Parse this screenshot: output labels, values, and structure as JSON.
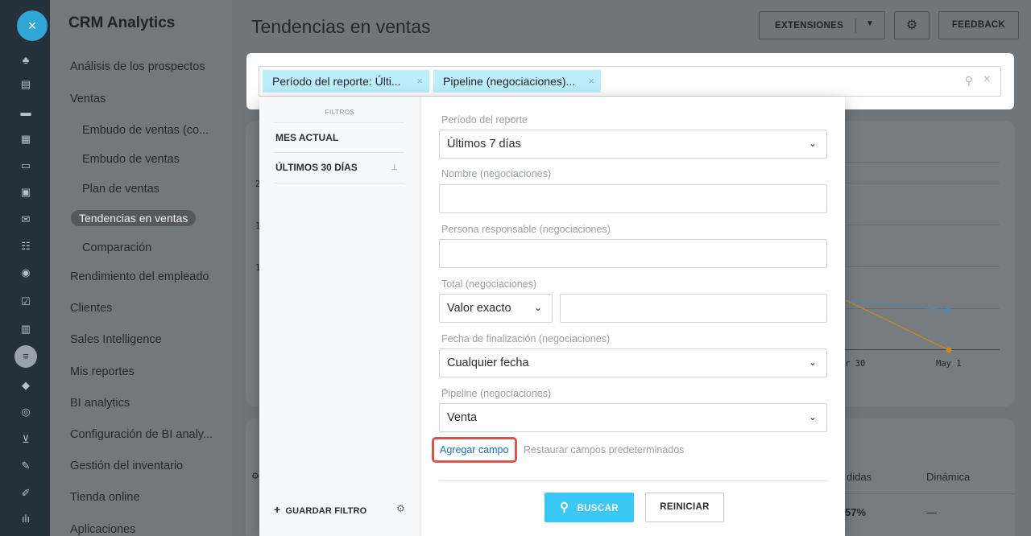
{
  "rail": {
    "close_label": "×",
    "icons": [
      "♣",
      "▤",
      "▬",
      "▦",
      "▭",
      "▣",
      "✉",
      "☷",
      "◉",
      "☑",
      "▥",
      "≡",
      "◆",
      "◎",
      "⊻",
      "✎",
      "✐",
      "ılı"
    ]
  },
  "nav": {
    "title": "CRM Analytics",
    "items": [
      {
        "label": "Análisis de los prospectos"
      },
      {
        "label": "Ventas"
      },
      {
        "label": "Embudo de ventas (co..."
      },
      {
        "label": "Embudo de ventas"
      },
      {
        "label": "Plan de ventas"
      },
      {
        "label": "Tendencias en ventas"
      },
      {
        "label": "Comparación"
      },
      {
        "label": "Rendimiento del empleado"
      },
      {
        "label": "Clientes"
      },
      {
        "label": "Sales Intelligence"
      },
      {
        "label": "Mis reportes"
      },
      {
        "label": "BI analytics"
      },
      {
        "label": "Configuración de BI analy..."
      },
      {
        "label": "Gestión del inventario"
      },
      {
        "label": "Tienda online"
      },
      {
        "label": "Aplicaciones"
      }
    ]
  },
  "header": {
    "title": "Tendencias en ventas",
    "extensions_label": "EXTENSIONES",
    "chevron": "▼",
    "gear": "⚙",
    "feedback_label": "FEEDBACK"
  },
  "filter_bar": {
    "chips": [
      {
        "label": "Período del reporte: Últi...",
        "remove": "×"
      },
      {
        "label": "Pipeline (negociaciones)...",
        "remove": "×"
      }
    ],
    "search_icon": "⚲",
    "clear_icon": "×"
  },
  "presets": {
    "header": "FILTROS",
    "items": [
      {
        "label": "MES ACTUAL"
      },
      {
        "label": "ÚLTIMOS 30 DÍAS",
        "pin": "⊥"
      }
    ],
    "save_plus": "+",
    "save_label": "GUARDAR FILTRO",
    "gear": "⚙"
  },
  "fields": {
    "period": {
      "label": "Período del reporte",
      "value": "Últimos 7 días"
    },
    "name": {
      "label": "Nombre (negociaciones)",
      "value": ""
    },
    "responsible": {
      "label": "Persona responsable (negociaciones)",
      "value": ""
    },
    "total": {
      "label": "Total (negociaciones)",
      "mode": "Valor exacto",
      "value": ""
    },
    "close_date": {
      "label": "Fecha de finalización (negociaciones)",
      "value": "Cualquier fecha"
    },
    "pipeline": {
      "label": "Pipeline (negociaciones)",
      "value": "Venta"
    },
    "caret": "⌄"
  },
  "actions": {
    "add_field": "Agregar campo",
    "restore_defaults": "Restaurar campos predeterminados",
    "search_icon": "⚲",
    "search_label": "BUSCAR",
    "reset_label": "REINICIAR"
  },
  "background": {
    "axis_fragments": [
      "2",
      "1",
      "1"
    ],
    "xticks": [
      "r 30",
      "May 1"
    ],
    "col_fragments": [
      "didas",
      "Dinámica"
    ],
    "cell_values": [
      "57%",
      "—"
    ],
    "gear_fragment": "⚙"
  },
  "chart_data": {
    "type": "line",
    "categories": [
      "r 30",
      "May 1"
    ],
    "series": [
      {
        "color": "#4b8bb0",
        "values": [
          1.0,
          0.8
        ]
      },
      {
        "color": "#c98a1f",
        "values": [
          1.0,
          0.0
        ]
      }
    ]
  }
}
